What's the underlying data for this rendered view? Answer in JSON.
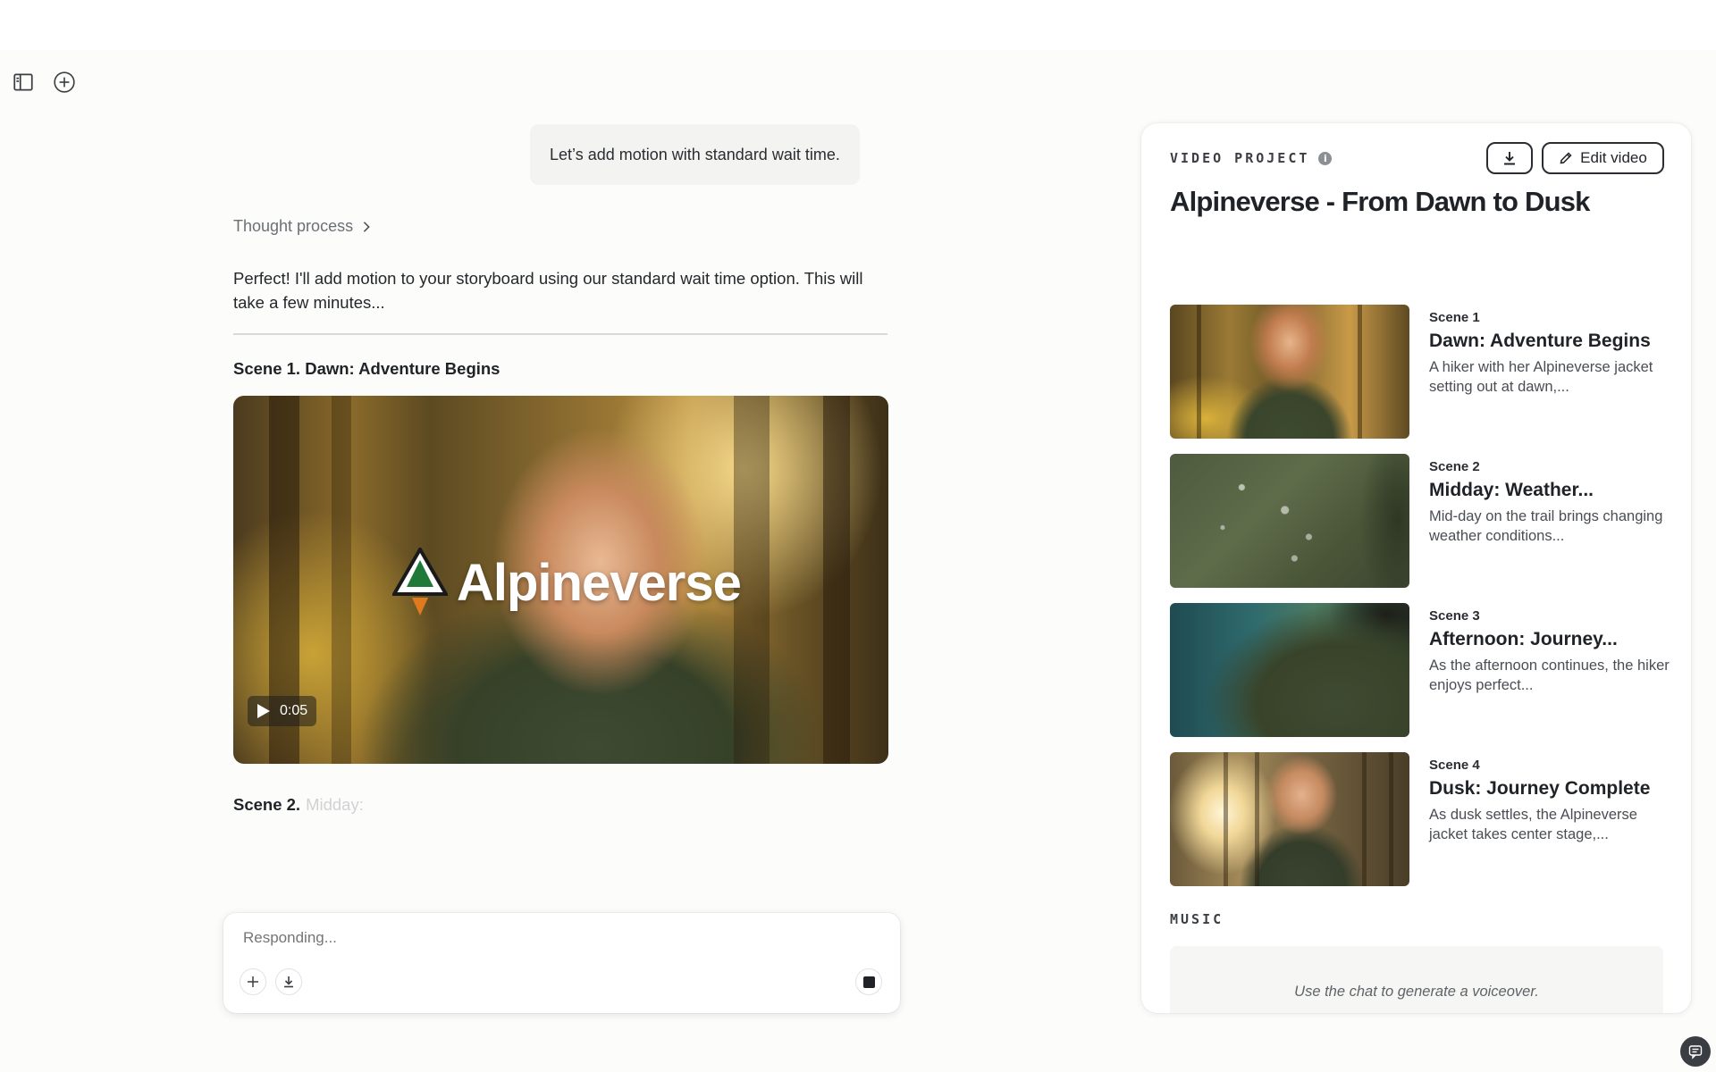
{
  "chat": {
    "user_message": "Let’s add motion with standard wait time.",
    "thought_process_label": "Thought process",
    "assistant_message": "Perfect! I'll add motion to your storyboard using our standard wait time option. This will take a few minutes...",
    "scene1_heading": "Scene 1. Dawn: Adventure Begins",
    "video": {
      "brand_text": "Alpineverse",
      "duration": "0:05"
    },
    "scene2_heading": "Scene 2.",
    "scene2_partial": "Midday:"
  },
  "composer": {
    "placeholder": "Responding..."
  },
  "panel": {
    "label": "VIDEO PROJECT",
    "info_glyph": "i",
    "edit_label": "Edit video",
    "project_title": "Alpineverse - From Dawn to Dusk",
    "scenes": [
      {
        "num": "Scene 1",
        "title": "Dawn: Adventure Begins",
        "desc": "A hiker with her Alpineverse jacket setting out at dawn,..."
      },
      {
        "num": "Scene 2",
        "title": "Midday: Weather...",
        "desc": "Mid-day on the trail brings changing weather conditions..."
      },
      {
        "num": "Scene 3",
        "title": "Afternoon: Journey...",
        "desc": "As the afternoon continues, the hiker enjoys perfect..."
      },
      {
        "num": "Scene 4",
        "title": "Dusk: Journey Complete",
        "desc": "As dusk settles, the Alpineverse jacket takes center stage,..."
      }
    ],
    "music_label": "MUSIC",
    "music_hint": "Use the chat to generate a voiceover."
  },
  "icons": {
    "sidebar_toggle": "sidebar-toggle-icon",
    "new_chat": "plus-circle-icon",
    "chevron": "chevron-right-icon",
    "play": "play-icon",
    "download": "download-icon",
    "edit": "pencil-icon",
    "stop": "stop-icon",
    "chat_help": "chat-bubble-icon"
  }
}
